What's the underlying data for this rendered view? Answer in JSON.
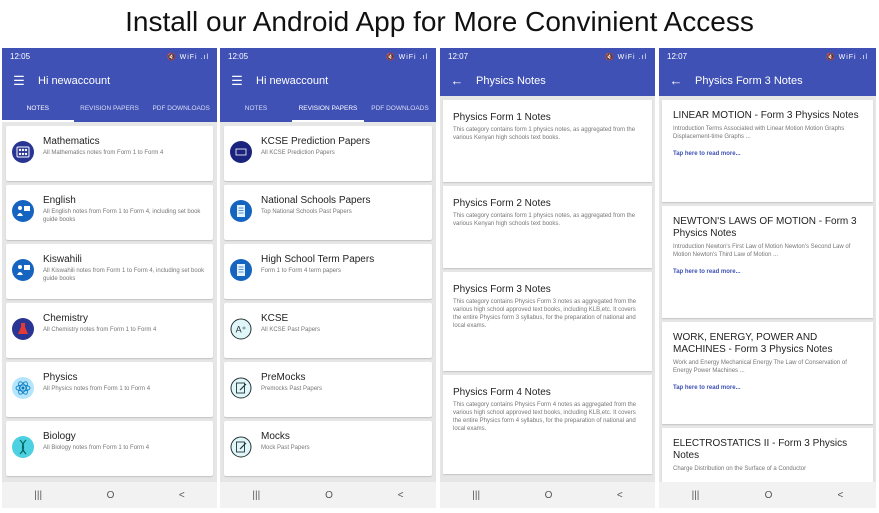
{
  "banner": "Install our Android App for More Convinient Access",
  "colors": {
    "primary": "#3f51b5",
    "background": "#e6e6e6",
    "card": "#ffffff"
  },
  "navbar": {
    "recent": "|||",
    "home": "O",
    "back": "<"
  },
  "screen1": {
    "time": "12:05",
    "status_icons": "🔇 WiFi .ıl",
    "greeting": "Hi newaccount",
    "menu_icon": "hamburger-icon",
    "tabs": [
      "NOTES",
      "REVISION PAPERS",
      "PDF DOWNLOADS"
    ],
    "active_tab": 0,
    "items": [
      {
        "title": "Mathematics",
        "desc": "All Mathematics notes from Form 1 to Form 4",
        "icon": "abacus-icon",
        "icon_color": "#283593"
      },
      {
        "title": "English",
        "desc": "All English notes from Form 1 to Form 4, including set book guide books",
        "icon": "teacher-icon",
        "icon_color": "#1565c0"
      },
      {
        "title": "Kiswahili",
        "desc": "All Kiswahili notes from Form 1 to Form 4, including set book guide books",
        "icon": "teacher-icon",
        "icon_color": "#1565c0"
      },
      {
        "title": "Chemistry",
        "desc": "All Chemistry notes from Form 1 to Form 4",
        "icon": "flask-icon",
        "icon_color": "#283593"
      },
      {
        "title": "Physics",
        "desc": "All Physics notes from Form 1 to Form 4",
        "icon": "atom-icon",
        "icon_color": "#b3e5fc"
      },
      {
        "title": "Biology",
        "desc": "All Biology notes from Form 1 to Form 4",
        "icon": "dna-icon",
        "icon_color": "#4dd0e1"
      }
    ]
  },
  "screen2": {
    "time": "12:05",
    "status_icons": "🔇 WiFi .ıl",
    "greeting": "Hi newaccount",
    "menu_icon": "hamburger-icon",
    "tabs": [
      "NOTES",
      "REVISION PAPERS",
      "PDF DOWNLOADS"
    ],
    "active_tab": 1,
    "items": [
      {
        "title": "KCSE Prediction Papers",
        "desc": "All KCSE Prediction Papers",
        "icon": "kcse-logo-icon"
      },
      {
        "title": "National Schools Papers",
        "desc": "Top National Schools Past Papers",
        "icon": "document-icon"
      },
      {
        "title": "High School Term Papers",
        "desc": "Form 1 to Form 4 term papers",
        "icon": "document-icon"
      },
      {
        "title": "KCSE",
        "desc": "All KCSE Past Papers",
        "icon": "a-plus-icon"
      },
      {
        "title": "PreMocks",
        "desc": "Premocks Past Papers",
        "icon": "edit-paper-icon"
      },
      {
        "title": "Mocks",
        "desc": "Mock Past Papers",
        "icon": "edit-paper-icon"
      }
    ]
  },
  "screen3": {
    "time": "12:07",
    "status_icons": "🔇 WiFi .ıl",
    "title": "Physics Notes",
    "back_icon": "arrow-back-icon",
    "items": [
      {
        "title": "Physics Form 1 Notes",
        "desc": "This category contains form 1 physics notes, as aggregated from the various Kenyan high schools text books."
      },
      {
        "title": "Physics Form 2 Notes",
        "desc": "This category contains form 1 physics notes, as aggregated from the various Kenyan high schools text books."
      },
      {
        "title": "Physics Form 3 Notes",
        "desc": "This category contains Physics Form 3 notes as aggregated from the various high school approved text books, including KLB,etc. It covers the entire Physics form 3 syllabus, for the preparation of national and local exams."
      },
      {
        "title": "Physics Form 4 Notes",
        "desc": "This category contains Physics Form 4 notes as aggregated from the various high school approved text books, including KLB,etc. It covers the entire Physics form 4 syllabus, for the preparation of national and local exams."
      }
    ]
  },
  "screen4": {
    "time": "12:07",
    "status_icons": "🔇 WiFi .ıl",
    "title": "Physics Form 3 Notes",
    "back_icon": "arrow-back-icon",
    "read_more": "Tap here to read more...",
    "items": [
      {
        "title": "LINEAR MOTION - Form 3 Physics Notes",
        "desc": "Introduction Terms Associated with Linear Motion Motion Graphs Displacement-time Graphs ..."
      },
      {
        "title": "NEWTON'S LAWS OF MOTION - Form 3 Physics Notes",
        "desc": "Introduction Newton's First Law of Motion Newton's Second Law of Motion Newton's Third Law of Motion ..."
      },
      {
        "title": "WORK, ENERGY, POWER AND MACHINES - Form 3 Physics Notes",
        "desc": "Work and Energy Mechanical Energy The Law of Conservation of Energy Power Machines ..."
      },
      {
        "title": "ELECTROSTATICS II - Form 3 Physics Notes",
        "desc": "Charge Distribution on the Surface of a Conductor"
      }
    ]
  }
}
